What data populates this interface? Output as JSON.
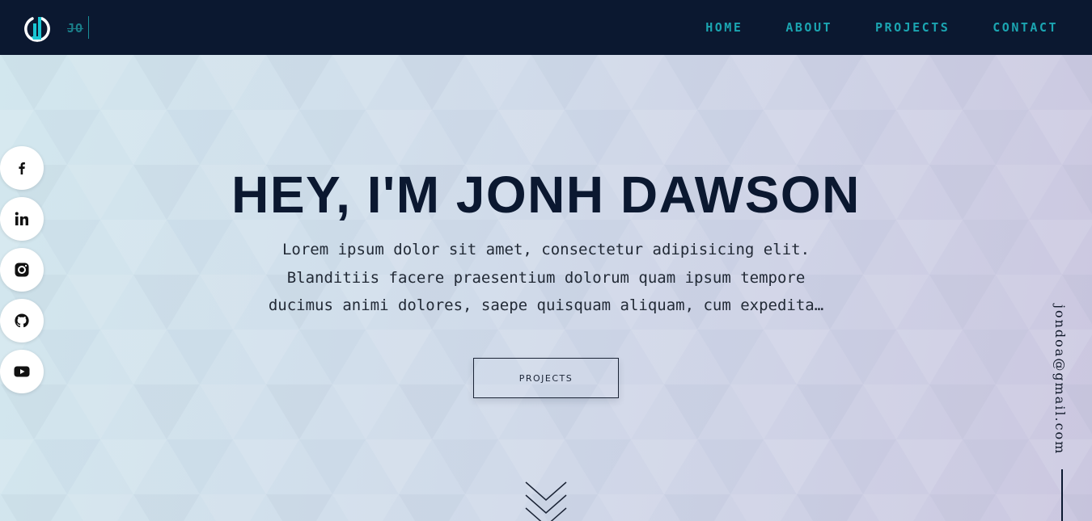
{
  "header": {
    "logo_text": "JO",
    "nav": [
      {
        "label": "HOME"
      },
      {
        "label": "ABOUT"
      },
      {
        "label": "PROJECTS"
      },
      {
        "label": "CONTACT"
      }
    ]
  },
  "colors": {
    "navbar": "#0b1830",
    "accent": "#1ba5b1",
    "title": "#0b1830"
  },
  "social": [
    {
      "icon": "facebook-icon"
    },
    {
      "icon": "linkedin-icon"
    },
    {
      "icon": "instagram-icon"
    },
    {
      "icon": "github-icon"
    },
    {
      "icon": "youtube-icon"
    }
  ],
  "hero": {
    "title": "HEY, I'M JONH DAWSON",
    "text": "Lorem ipsum dolor sit amet, consectetur adipisicing elit. Blanditiis facere praesentium dolorum quam ipsum tempore ducimus animi dolores, saepe quisquam aliquam, cum expedita…",
    "button_label": "PROJECTS",
    "scroll_icon": "chevrons-down-icon"
  },
  "email": "jondoa@gmail.com"
}
